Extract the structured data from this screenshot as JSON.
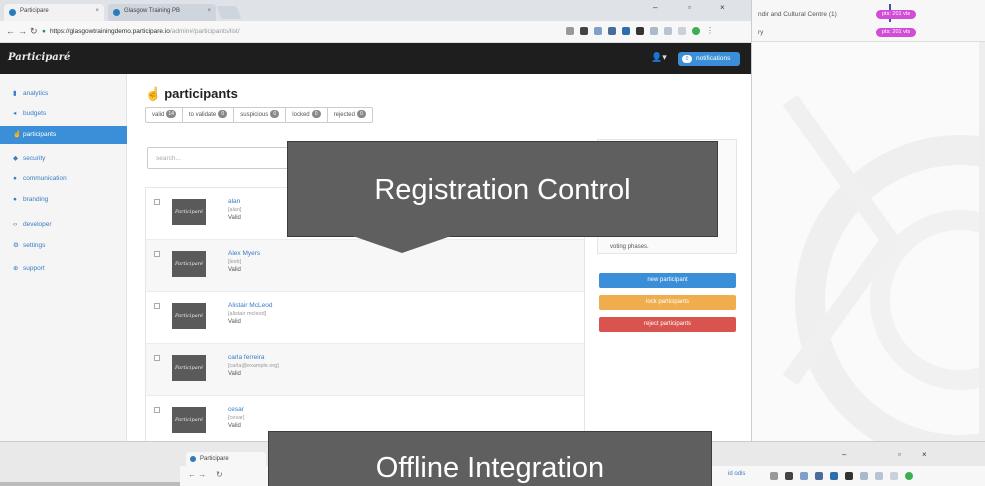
{
  "browser": {
    "tabs": [
      {
        "label": "Participare"
      },
      {
        "label": "Glasgow Training PB"
      }
    ],
    "url": {
      "host": "https://glasgowtrainingdemo.participare.io",
      "path": "/admin#/participants/list/"
    }
  },
  "background_window": {
    "row1_text": "ndir and Cultural Centre (1)",
    "row1_pill": "pts: 201 vts",
    "row2_text": "ry",
    "row2_pill": "pts: 201 vts"
  },
  "app": {
    "logo": "Participaré",
    "notifications_label": "notifications",
    "notifications_count": "0"
  },
  "sidebar": {
    "items": [
      {
        "label": "analytics",
        "icon": "bar-chart-icon"
      },
      {
        "label": "budgets",
        "icon": "budget-icon"
      },
      {
        "label": "participants",
        "icon": "hand-icon"
      },
      {
        "label": "security",
        "icon": "shield-icon"
      },
      {
        "label": "communication",
        "icon": "chat-icon"
      },
      {
        "label": "branding",
        "icon": "palette-icon"
      },
      {
        "label": "developer",
        "icon": "code-icon"
      },
      {
        "label": "settings",
        "icon": "gear-icon"
      },
      {
        "label": "support",
        "icon": "life-ring-icon"
      }
    ]
  },
  "main": {
    "title": "participants",
    "filters": [
      {
        "label": "valid",
        "count": "14"
      },
      {
        "label": "to validate",
        "count": "0"
      },
      {
        "label": "suspicious",
        "count": "0"
      },
      {
        "label": "locked",
        "count": "0"
      },
      {
        "label": "rejected",
        "count": "0"
      }
    ],
    "search_placeholder": "search..."
  },
  "participants": [
    {
      "name": "alan",
      "username": "[alan]",
      "status": "Valid",
      "thumb": "Participaré"
    },
    {
      "name": "Alex Myers",
      "username": "[lexb]",
      "status": "Valid",
      "thumb": "Participaré"
    },
    {
      "name": "Alistair McLeod",
      "username": "[alistair mcleod]",
      "status": "Valid",
      "thumb": "Participaré"
    },
    {
      "name": "carla ferreira",
      "username": "[carla@example.org]",
      "status": "Valid",
      "thumb": "Participaré"
    },
    {
      "name": "cesar",
      "username": "[cesar]",
      "status": "Valid",
      "thumb": "Participaré"
    }
  ],
  "right_panel": {
    "hint": "voting phases.",
    "buttons": [
      {
        "label": "new participant",
        "color": "#3a8fd8"
      },
      {
        "label": "lock participants",
        "color": "#f0ad4e"
      },
      {
        "label": "reject participants",
        "color": "#d9534f"
      }
    ]
  },
  "callouts": {
    "registration": "Registration Control",
    "offline": "Offline Integration"
  },
  "lower_window": {
    "tab_label": "Participare",
    "url_fragment": "id odis"
  }
}
